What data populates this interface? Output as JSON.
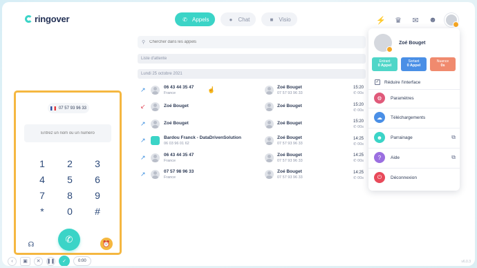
{
  "app": {
    "logo_text": "ringover"
  },
  "header": {
    "tabs": [
      {
        "label": "Appels",
        "icon": "phone-icon"
      },
      {
        "label": "Chat",
        "icon": "chat-icon"
      },
      {
        "label": "Visio",
        "icon": "video-icon"
      }
    ],
    "active_tab": "Appels",
    "icons": [
      "lightning-icon",
      "crown-icon",
      "message-icon",
      "team-icon"
    ]
  },
  "search": {
    "placeholder": "Chercher dans les appels"
  },
  "list": {
    "waiting_label": "Liste d'attente",
    "date_label": "Lundi 25 octobre 2021",
    "rows": [
      {
        "direction": "out",
        "caller": "06 43 44 35 47",
        "caller_sub": "France",
        "callee": "Zoé Bouget",
        "callee_sub": "07 57 93 96 33",
        "time": "15:20",
        "duration": "00s"
      },
      {
        "direction": "missed",
        "caller": "Zoé Bouget",
        "caller_sub": "",
        "callee": "Zoé Bouget",
        "callee_sub": "",
        "time": "15:20",
        "duration": "00s"
      },
      {
        "direction": "out",
        "caller": "Zoé Bouget",
        "caller_sub": "",
        "callee": "Zoé Bouget",
        "callee_sub": "",
        "time": "15:20",
        "duration": "00s"
      },
      {
        "direction": "out",
        "caller": "Bardou Franck - DataDrivenSolution",
        "caller_sub": "06 03 96 01 62",
        "callee": "Zoé Bouget",
        "callee_sub": "07 57 93 96 33",
        "time": "14:25",
        "duration": "00s"
      },
      {
        "direction": "out",
        "caller": "06 43 44 35 47",
        "caller_sub": "France",
        "callee": "Zoé Bouget",
        "callee_sub": "07 57 93 96 33",
        "time": "14:25",
        "duration": "00s"
      },
      {
        "direction": "out",
        "caller": "07 57 98 96 33",
        "caller_sub": "France",
        "callee": "Zoé Bouget",
        "callee_sub": "07 57 93 96 33",
        "time": "14:25",
        "duration": "00s"
      }
    ]
  },
  "dialer": {
    "number": "07 57 93 96 33",
    "input_placeholder": "Entrez un nom ou un numéro",
    "keys": [
      "1",
      "2",
      "3",
      "4",
      "5",
      "6",
      "7",
      "8",
      "9",
      "*",
      "0",
      "#"
    ]
  },
  "toolbar": {
    "timer": "0:00"
  },
  "menu": {
    "name": "Zoé Bouget",
    "stats": [
      {
        "label": "Entrant",
        "value": "0 Appel",
        "color": "#4fd6c8"
      },
      {
        "label": "Sortant",
        "value": "0 Appel",
        "color": "#4a8fe6"
      },
      {
        "label": "Nuance",
        "value": "0s",
        "color": "#f08a6e"
      }
    ],
    "reduce_label": "Réduire l'interface",
    "items": [
      {
        "label": "Paramètres",
        "icon": "settings-icon",
        "color": "#e05a7a"
      },
      {
        "label": "Téléchargements",
        "icon": "cloud-icon",
        "color": "#4a8fe6"
      },
      {
        "label": "Parrainage",
        "icon": "people-icon",
        "color": "#3bd4c7"
      },
      {
        "label": "Aide",
        "icon": "help-icon",
        "color": "#9b6fe0"
      },
      {
        "label": "Déconnexion",
        "icon": "power-icon",
        "color": "#e84a5a"
      }
    ]
  },
  "version": "v6.0.3"
}
